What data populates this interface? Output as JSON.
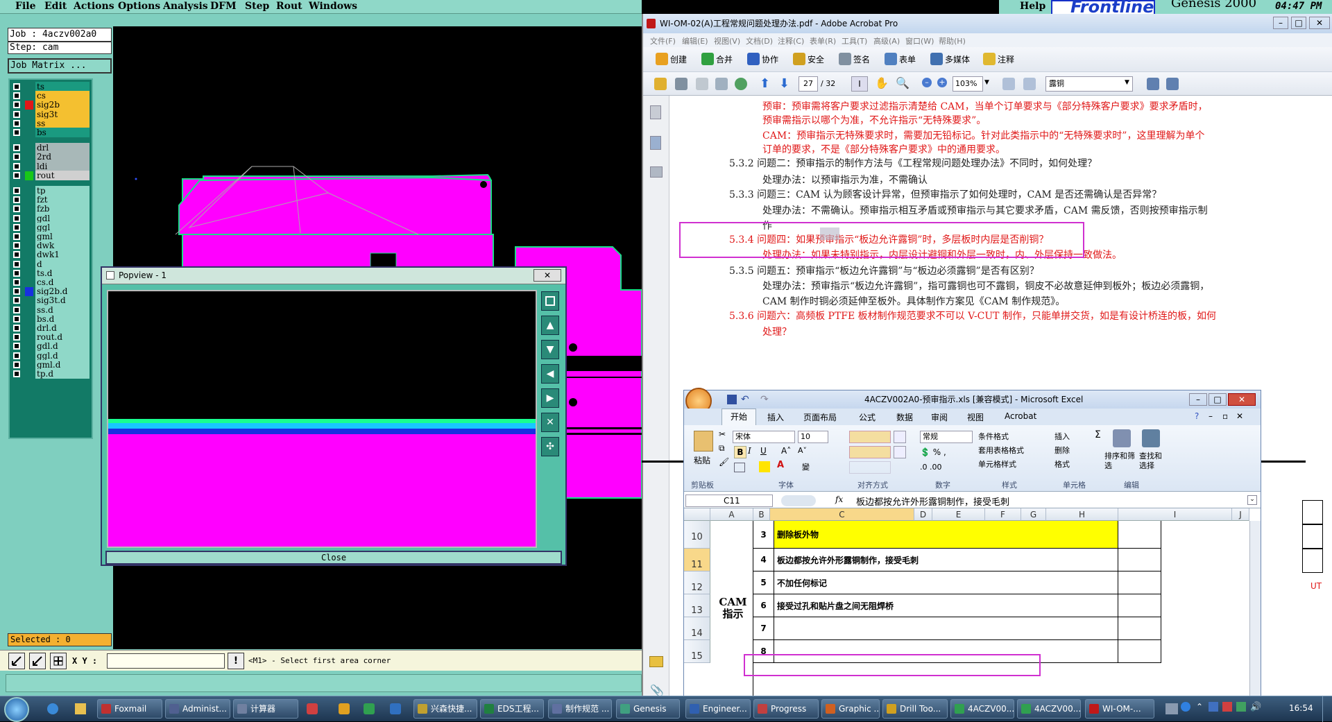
{
  "genesis": {
    "menu": [
      "File",
      "Edit",
      "Actions",
      "Options",
      "Analysis",
      "DFM",
      "Step",
      "Rout",
      "Windows"
    ],
    "help": "Help",
    "brand": "Frontline",
    "product": "Genesis 2000",
    "clock": "04:47 PM",
    "job": "Job : 4aczv002a0",
    "step": "Step: cam",
    "job_matrix": "Job Matrix ...",
    "layers": [
      {
        "name": "ts",
        "color": "#1a9a80",
        "swatch": ""
      },
      {
        "name": "cs",
        "color": "#f4c030",
        "swatch": ""
      },
      {
        "name": "sig2b",
        "color": "#f4c030",
        "swatch": "#e01818"
      },
      {
        "name": "sig3t",
        "color": "#f4c030",
        "swatch": ""
      },
      {
        "name": "ss",
        "color": "#f4c030",
        "swatch": ""
      },
      {
        "name": "bs",
        "color": "#1a9a80",
        "swatch": ""
      },
      {
        "name": "drl",
        "color": "#a8b8b8",
        "swatch": ""
      },
      {
        "name": "2rd",
        "color": "#a8b8b8",
        "swatch": ""
      },
      {
        "name": "ldi",
        "color": "#a8b8b8",
        "swatch": ""
      },
      {
        "name": "rout",
        "color": "#d0d0d0",
        "swatch": "#18c818"
      },
      {
        "name": "tp",
        "color": "#8fd8c8",
        "swatch": ""
      },
      {
        "name": "fzt",
        "color": "#8fd8c8",
        "swatch": ""
      },
      {
        "name": "fzb",
        "color": "#8fd8c8",
        "swatch": ""
      },
      {
        "name": "gdl",
        "color": "#8fd8c8",
        "swatch": ""
      },
      {
        "name": "ggl",
        "color": "#8fd8c8",
        "swatch": ""
      },
      {
        "name": "gml",
        "color": "#8fd8c8",
        "swatch": ""
      },
      {
        "name": "dwk",
        "color": "#8fd8c8",
        "swatch": ""
      },
      {
        "name": "dwk1",
        "color": "#8fd8c8",
        "swatch": ""
      },
      {
        "name": "d",
        "color": "#8fd8c8",
        "swatch": ""
      },
      {
        "name": "ts.d",
        "color": "#8fd8c8",
        "swatch": ""
      },
      {
        "name": "cs.d",
        "color": "#8fd8c8",
        "swatch": ""
      },
      {
        "name": "sig2b.d",
        "color": "#8fd8c8",
        "swatch": "#1830e0"
      },
      {
        "name": "sig3t.d",
        "color": "#8fd8c8",
        "swatch": ""
      },
      {
        "name": "ss.d",
        "color": "#8fd8c8",
        "swatch": ""
      },
      {
        "name": "bs.d",
        "color": "#8fd8c8",
        "swatch": ""
      },
      {
        "name": "drl.d",
        "color": "#8fd8c8",
        "swatch": ""
      },
      {
        "name": "rout.d",
        "color": "#8fd8c8",
        "swatch": ""
      },
      {
        "name": "gdl.d",
        "color": "#8fd8c8",
        "swatch": ""
      },
      {
        "name": "ggl.d",
        "color": "#8fd8c8",
        "swatch": ""
      },
      {
        "name": "gml.d",
        "color": "#8fd8c8",
        "swatch": ""
      },
      {
        "name": "tp.d",
        "color": "#8fd8c8",
        "swatch": ""
      }
    ],
    "selected": "Selected : 0",
    "xy_label": "X Y :",
    "prompt": "<M1> - Select first area corner",
    "popview_title": "Popview - 1",
    "popview_close": "Close"
  },
  "acrobat": {
    "title": "WI-OM-02(A)工程常规问题处理办法.pdf - Adobe Acrobat Pro",
    "menu": [
      "文件(F)",
      "编辑(E)",
      "视图(V)",
      "文档(D)",
      "注释(C)",
      "表单(R)",
      "工具(T)",
      "高级(A)",
      "窗口(W)",
      "帮助(H)"
    ],
    "toolbar1": [
      "创建",
      "合并",
      "协作",
      "安全",
      "签名",
      "表单",
      "多媒体",
      "注释"
    ],
    "page": "27",
    "page_total": "/ 32",
    "zoom": "103%",
    "search": "露铜",
    "lines": [
      {
        "text": "预审：预审需将客户要求过滤指示清楚给 CAM，当单个订单要求与《部分特殊客户要求》要求矛盾时，",
        "cls": "red"
      },
      {
        "text": "预审需指示以哪个为准，不允许指示“无特殊要求”。",
        "cls": "red"
      },
      {
        "text": "CAM：预审指示无特殊要求时，需要加无铅标记。针对此类指示中的“无特殊要求时”，这里理解为单个",
        "cls": "red"
      },
      {
        "text": "订单的要求，不是《部分特殊客户要求》中的通用要求。",
        "cls": "red"
      },
      {
        "text": "5.3.2  问题二：预审指示的制作方法与《工程常规问题处理办法》不同时，如何处理？",
        "cls": "blk"
      },
      {
        "text": "处理办法：以预审指示为准，不需确认",
        "cls": "blk"
      },
      {
        "text": "5.3.3  问题三：CAM 认为顾客设计异常，但预审指示了如何处理时，CAM 是否还需确认是否异常？",
        "cls": "blk"
      },
      {
        "text": "处理办法：不需确认。预审指示相互矛盾或预审指示与其它要求矛盾，CAM 需反馈，否则按预审指示制",
        "cls": "blk"
      },
      {
        "text": "作",
        "cls": "blk"
      },
      {
        "text": "5.3.4  问题四：如果预审指示“板边允许露铜”时，多层板时内层是否削铜？",
        "cls": "red"
      },
      {
        "text": "处理办法：如果未特别指示，内层设计避铜和外层一致时，内、外层保持一致做法。",
        "cls": "red"
      },
      {
        "text": "5.3.5  问题五：预审指示“板边允许露铜”与“板边必须露铜”是否有区别？",
        "cls": "blk"
      },
      {
        "text": "处理办法：预审指示“板边允许露铜”，指可露铜也可不露铜，铜皮不必故意延伸到板外；板边必须露铜，",
        "cls": "blk"
      },
      {
        "text": "CAM 制作时铜必须延伸至板外。具体制作方案见《CAM 制作规范》。",
        "cls": "blk"
      },
      {
        "text": "5.3.6  问题六：高频板 PTFE 板材制作规范要求不可以 V-CUT 制作，只能单拼交货，如是有设计桥连的板，如何",
        "cls": "red"
      },
      {
        "text": "处理？",
        "cls": "red"
      }
    ],
    "margin_red": [
      "UT"
    ]
  },
  "excel": {
    "title": "4ACZV002A0-预审指示.xls  [兼容模式] - Microsoft Excel",
    "tabs": [
      "开始",
      "插入",
      "页面布局",
      "公式",
      "数据",
      "审阅",
      "视图",
      "Acrobat"
    ],
    "font": "宋体",
    "size": "10",
    "number_format": "常规",
    "ribbon_buttons": [
      "粘贴",
      "条件格式",
      "套用表格格式",
      "单元格样式",
      "插入",
      "删除",
      "格式",
      "排序和筛选",
      "查找和选择"
    ],
    "groups": [
      "剪贴板",
      "字体",
      "对齐方式",
      "数字",
      "样式",
      "单元格",
      "编辑"
    ],
    "name_box": "C11",
    "formula": "板边都按允许外形露铜制作，接受毛刺",
    "columns": [
      "A",
      "B",
      "C",
      "D",
      "E",
      "F",
      "G",
      "H",
      "I",
      "J"
    ],
    "rows": [
      "10",
      "11",
      "12",
      "13",
      "14",
      "15"
    ],
    "merged_label": "CAM\n指示",
    "cells": [
      {
        "num": "3",
        "text": "删除板外物"
      },
      {
        "num": "4",
        "text": "板边都按允许外形露铜制作，接受毛刺"
      },
      {
        "num": "5",
        "text": "不加任何标记"
      },
      {
        "num": "6",
        "text": "接受过孔和贴片盘之间无阻焊桥"
      },
      {
        "num": "7",
        "text": ""
      },
      {
        "num": "8",
        "text": ""
      }
    ]
  },
  "taskbar": {
    "items": [
      "Foxmail",
      "Administ...",
      "计算器",
      "兴森快捷...",
      "EDS工程...",
      "制作规范 ...",
      "Genesis",
      "Engineer...",
      "Progress",
      "Graphic ...",
      "Drill Too...",
      "4ACZV00...",
      "4ACZV00...",
      "WI-OM-..."
    ],
    "time": "16:54"
  }
}
